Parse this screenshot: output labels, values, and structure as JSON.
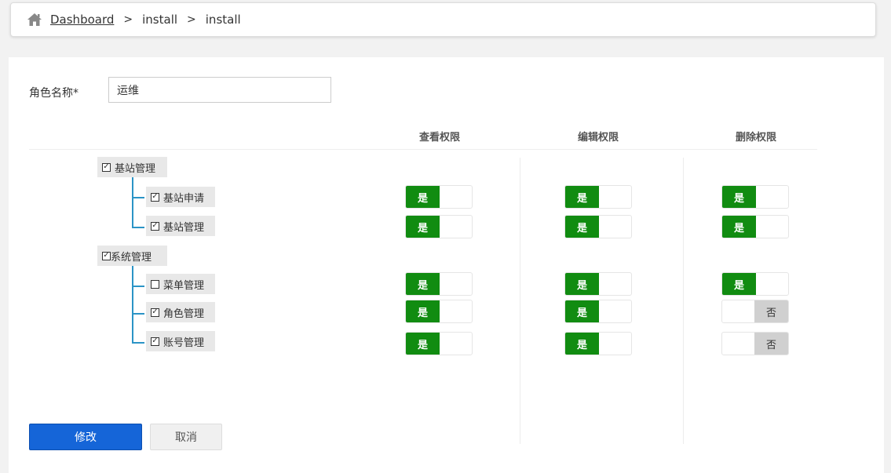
{
  "breadcrumb": {
    "icon": "home-icon",
    "items": [
      "Dashboard",
      "install",
      "install"
    ],
    "separator": ">"
  },
  "form": {
    "role_name_label": "角色名称*",
    "role_name_value": "运维"
  },
  "columns": [
    "查看权限",
    "编辑权限",
    "删除权限"
  ],
  "toggle_labels": {
    "on": "是",
    "off": "否"
  },
  "tree": [
    {
      "label": "基站管理",
      "checked": true,
      "children": [
        {
          "label": "基站申请",
          "checked": true,
          "perms": [
            true,
            true,
            true
          ]
        },
        {
          "label": "基站管理",
          "checked": true,
          "perms": [
            true,
            true,
            true
          ]
        }
      ]
    },
    {
      "label": "系统管理",
      "checked": true,
      "children": [
        {
          "label": "菜单管理",
          "checked": false,
          "perms": [
            true,
            true,
            true
          ]
        },
        {
          "label": "角色管理",
          "checked": true,
          "perms": [
            true,
            true,
            false
          ]
        },
        {
          "label": "账号管理",
          "checked": true,
          "perms": [
            true,
            true,
            false
          ]
        }
      ]
    }
  ],
  "buttons": {
    "submit": "修改",
    "cancel": "取消"
  },
  "colors": {
    "accent": "#1565d8",
    "toggle_on": "#118c11",
    "toggle_off": "#d0d0d0",
    "tree_line": "#2b94c6"
  }
}
